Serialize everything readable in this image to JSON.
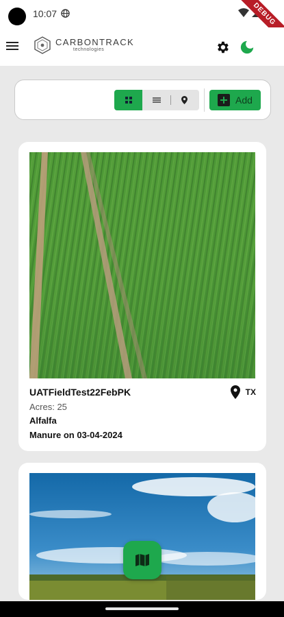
{
  "status_bar": {
    "time": "10:07",
    "debug_label": "DEBUG"
  },
  "app_bar": {
    "logo_main": "CARBONTRACK",
    "logo_sub": "technologies",
    "icons": [
      "menu-icon",
      "gear-icon",
      "moon-icon"
    ]
  },
  "toolbar": {
    "views": [
      "grid-view",
      "list-view",
      "map-view"
    ],
    "active_view": "grid-view",
    "add_label": "Add"
  },
  "fields": [
    {
      "name": "UATFieldTest22FebPK",
      "state": "TX",
      "acres_text": "Acres: 25",
      "crop": "Alfalfa",
      "activity": "Manure on 03-04-2024",
      "photo": "green crop field aerial"
    },
    {
      "photo": "blue sky over farmland"
    }
  ],
  "colors": {
    "accent": "#1ea84d",
    "background": "#e9e9e9",
    "card": "#ffffff",
    "debug_ribbon": "#b81d27"
  }
}
